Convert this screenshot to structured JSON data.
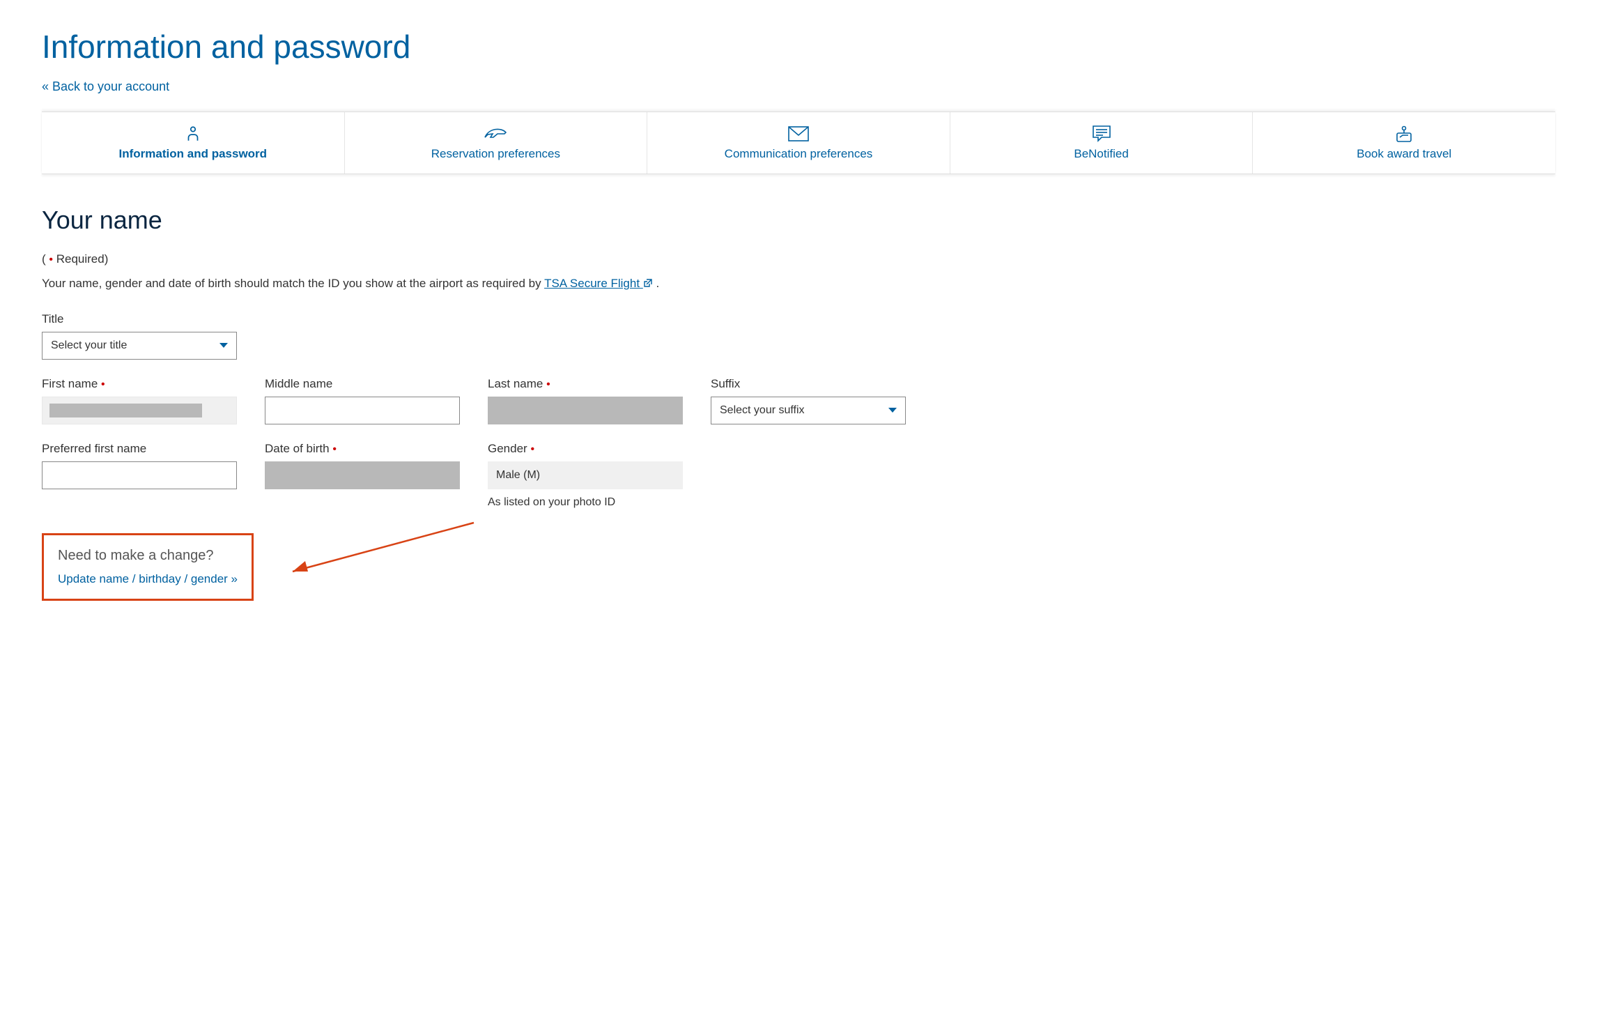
{
  "header": {
    "title": "Information and password",
    "back_link": "« Back to your account"
  },
  "tabs": [
    {
      "label": "Information and password",
      "icon": "person-icon",
      "active": true
    },
    {
      "label": "Reservation preferences",
      "icon": "plane-icon",
      "active": false
    },
    {
      "label": "Communication preferences",
      "icon": "envelope-icon",
      "active": false
    },
    {
      "label": "BeNotified",
      "icon": "chat-icon",
      "active": false
    },
    {
      "label": "Book award travel",
      "icon": "award-travel-icon",
      "active": false
    }
  ],
  "section": {
    "title": "Your name",
    "required_note_prefix": "( ",
    "required_note_suffix": " Required)",
    "description_prefix": "Your name, gender and date of birth should match the ID you show at the airport as required by ",
    "tsa_link": "TSA Secure Flight",
    "description_suffix": " ."
  },
  "form": {
    "title_label": "Title",
    "title_placeholder": "Select your title",
    "first_name_label": "First name",
    "middle_name_label": "Middle name",
    "last_name_label": "Last name",
    "suffix_label": "Suffix",
    "suffix_placeholder": "Select your suffix",
    "preferred_first_name_label": "Preferred first name",
    "dob_label": "Date of birth",
    "gender_label": "Gender",
    "gender_value": "Male (M)",
    "gender_helper": "As listed on your photo ID"
  },
  "change_box": {
    "heading": "Need to make a change?",
    "link": "Update name / birthday / gender »"
  }
}
